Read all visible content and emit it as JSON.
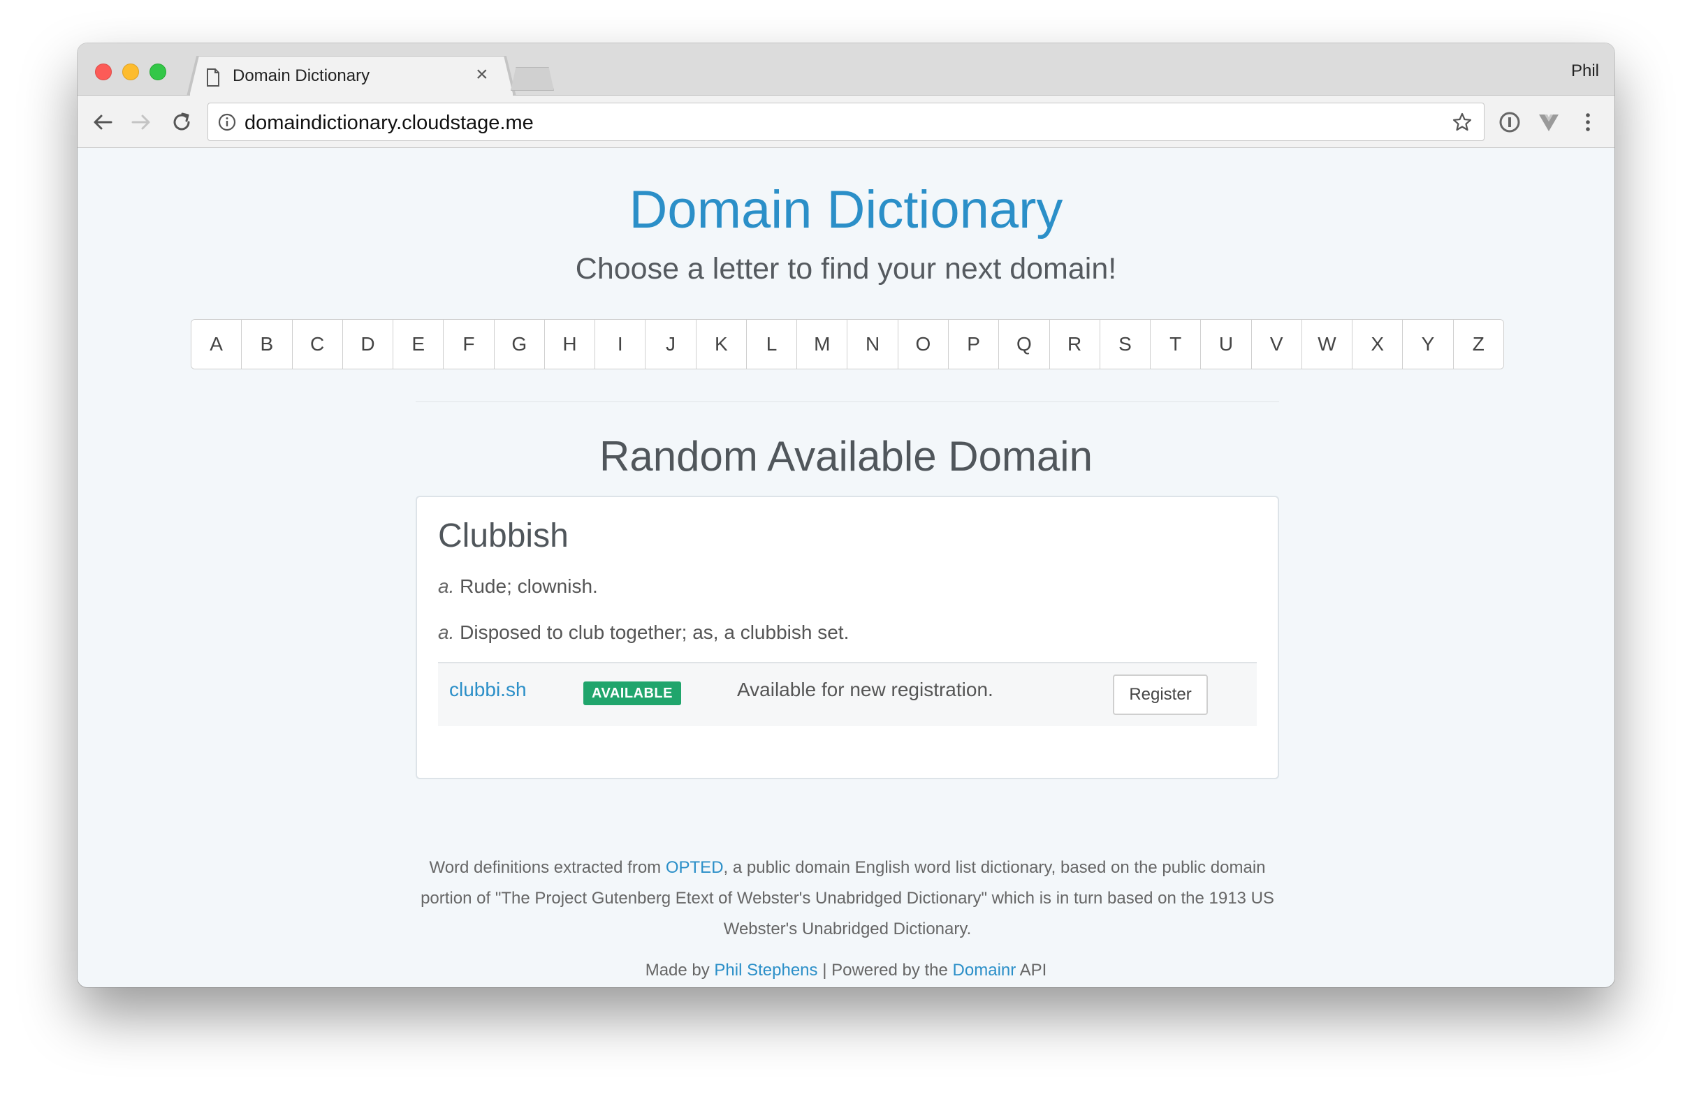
{
  "browser": {
    "tab_title": "Domain Dictionary",
    "close_label": "×",
    "profile_name": "Phil",
    "url": "domaindictionary.cloudstage.me"
  },
  "page": {
    "site_title": "Domain Dictionary",
    "subtitle": "Choose a letter to find your next domain!",
    "letters": [
      "A",
      "B",
      "C",
      "D",
      "E",
      "F",
      "G",
      "H",
      "I",
      "J",
      "K",
      "L",
      "M",
      "N",
      "O",
      "P",
      "Q",
      "R",
      "S",
      "T",
      "U",
      "V",
      "W",
      "X",
      "Y",
      "Z"
    ],
    "section_title": "Random Available Domain"
  },
  "card": {
    "word": "Clubbish",
    "definitions": [
      {
        "pos": "a.",
        "text": "Rude; clownish."
      },
      {
        "pos": "a.",
        "text": "Disposed to club together; as, a clubbish set."
      }
    ],
    "domain": "clubbi.sh",
    "badge": "AVAILABLE",
    "status": "Available for new registration.",
    "register_label": "Register"
  },
  "footer": {
    "part1": "Word definitions extracted from ",
    "opted_link": "OPTED",
    "part2": ", a public domain English word list dictionary, based on the public domain portion of \"The Project Gutenberg Etext of Webster's Unabridged Dictionary\" which is in turn based on the 1913 US Webster's Unabridged Dictionary.",
    "made_by": "Made by ",
    "author_link": "Phil Stephens",
    "powered": " | Powered by the ",
    "domainr_link": "Domainr",
    "api": " API"
  },
  "colors": {
    "brand": "#2b8fc8",
    "badge": "#20a56c"
  }
}
